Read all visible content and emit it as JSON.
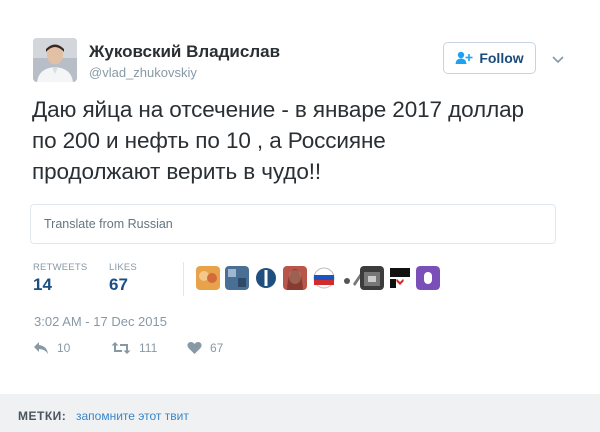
{
  "author": {
    "name": "Жуковский Владислав",
    "handle": "@vlad_zhukovskiy"
  },
  "follow_button": {
    "label": "Follow",
    "icon": "add-user-icon"
  },
  "tweet": {
    "lines": [
      "Даю яйца на отсечение - в январе 2017 доллар",
      "по 200 и нефть по 10 , а Россияне",
      "продолжают верить в чудо!!"
    ]
  },
  "translate": {
    "label": "Translate from Russian"
  },
  "stats": {
    "retweets_label": "RETWEETS",
    "retweets_value": "14",
    "likes_label": "LIKES",
    "likes_value": "67"
  },
  "timestamp": "3:02 AM - 17 Dec 2015",
  "actions": {
    "reply_count": "10",
    "retweet_count": "111",
    "like_count": "67"
  },
  "tags": {
    "label": "МЕТКИ:",
    "link": "запомните этот твит"
  },
  "colors": {
    "accent": "#1b4f84",
    "muted": "#8899a6",
    "link": "#3a86c8"
  }
}
